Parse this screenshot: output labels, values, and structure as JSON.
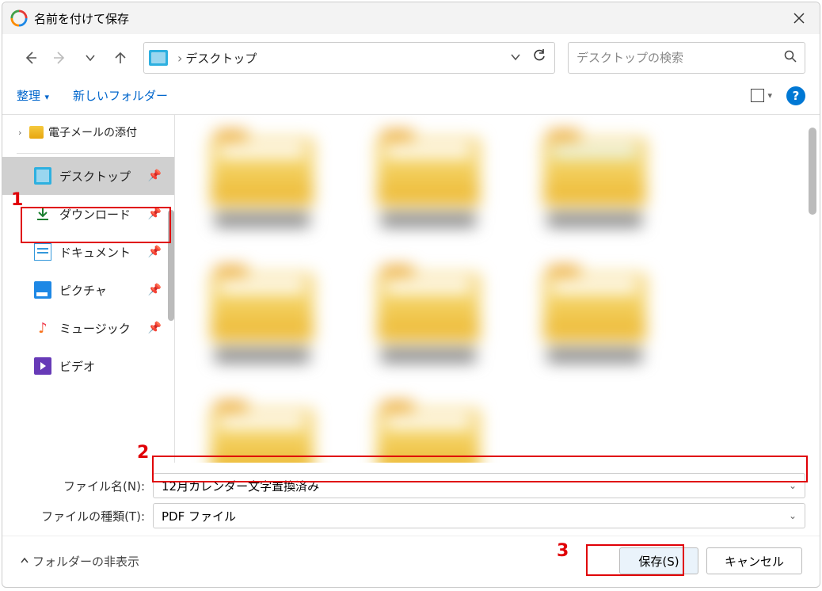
{
  "window": {
    "title": "名前を付けて保存"
  },
  "nav": {
    "crumb": "デスクトップ"
  },
  "search": {
    "placeholder": "デスクトップの検索"
  },
  "toolbar": {
    "organize": "整理",
    "newfolder": "新しいフォルダー"
  },
  "tree": {
    "attachment": "電子メールの添付"
  },
  "sidebar": {
    "items": [
      {
        "label": "デスクトップ"
      },
      {
        "label": "ダウンロード"
      },
      {
        "label": "ドキュメント"
      },
      {
        "label": "ピクチャ"
      },
      {
        "label": "ミュージック"
      },
      {
        "label": "ビデオ"
      }
    ]
  },
  "fields": {
    "filename_label": "ファイル名(N):",
    "filename_value": "12月カレンダー文字置換済み",
    "filetype_label": "ファイルの種類(T):",
    "filetype_value": "PDF ファイル"
  },
  "footer": {
    "hide": "フォルダーの非表示",
    "save": "保存(S)",
    "cancel": "キャンセル"
  },
  "annotations": {
    "n1": "1",
    "n2": "2",
    "n3": "3"
  }
}
